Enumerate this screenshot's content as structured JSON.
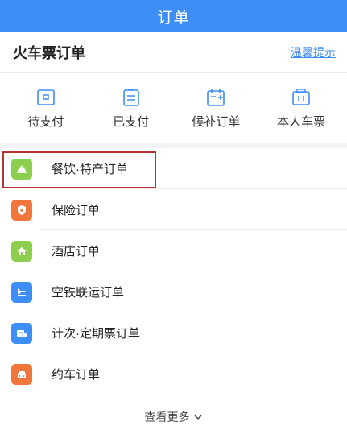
{
  "header": {
    "title": "订单"
  },
  "section": {
    "title": "火车票订单",
    "tips_link": "温馨提示"
  },
  "quick_actions": [
    {
      "label": "待支付",
      "icon": "wallet-icon"
    },
    {
      "label": "已支付",
      "icon": "clipboard-icon"
    },
    {
      "label": "候补订单",
      "icon": "calendar-plus-icon"
    },
    {
      "label": "本人车票",
      "icon": "ticket-icon"
    }
  ],
  "orders": [
    {
      "label": "餐饮·特产订单",
      "icon": "food-cloche-icon",
      "color": "#8ccf4f"
    },
    {
      "label": "保险订单",
      "icon": "shield-icon",
      "color": "#f0763c"
    },
    {
      "label": "酒店订单",
      "icon": "hotel-icon",
      "color": "#8ccf4f"
    },
    {
      "label": "空铁联运订单",
      "icon": "plane-train-icon",
      "color": "#3e8ef7"
    },
    {
      "label": "计次·定期票订单",
      "icon": "multi-ticket-icon",
      "color": "#3e8ef7"
    },
    {
      "label": "约车订单",
      "icon": "car-icon",
      "color": "#f0763c"
    }
  ],
  "more": {
    "label": "查看更多"
  },
  "colors": {
    "primary": "#3e8ef7",
    "highlight": "#b53333"
  }
}
